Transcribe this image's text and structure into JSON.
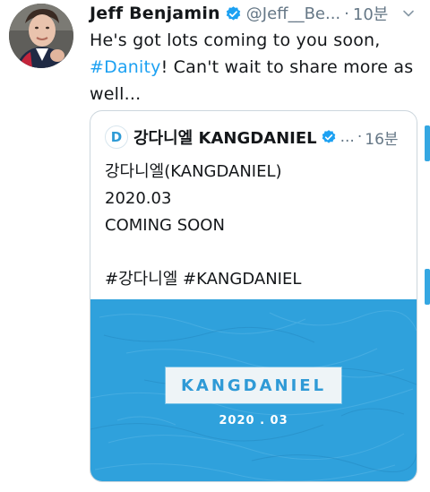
{
  "tweet": {
    "author_name": "Jeff Benjamin",
    "handle": "@Jeff__Be...",
    "time_sep": "·",
    "time": "10분",
    "text_line1": "He's got lots coming to you soon,",
    "hashtag": "#Danity",
    "text_line2_rest": "! Can't wait to share more as",
    "text_line3": "well..."
  },
  "quote": {
    "author_name": "강다니엘 KANGDANIEL",
    "handle": "...",
    "time_sep": "·",
    "time": "16분",
    "avatar_letter": "D",
    "lines": [
      "강다니엘(KANGDANIEL)",
      "2020.03",
      "COMING SOON",
      "",
      "#강다니엘 #KANGDANIEL"
    ],
    "media": {
      "logo_text": "KANGDANIEL",
      "date_text": "2020 . 03"
    }
  },
  "icons": {
    "verified": "verified-badge-icon",
    "caret": "chevron-down-icon"
  },
  "colors": {
    "link": "#1da1f2",
    "media_background": "#2fa1dc",
    "muted": "#657786"
  }
}
